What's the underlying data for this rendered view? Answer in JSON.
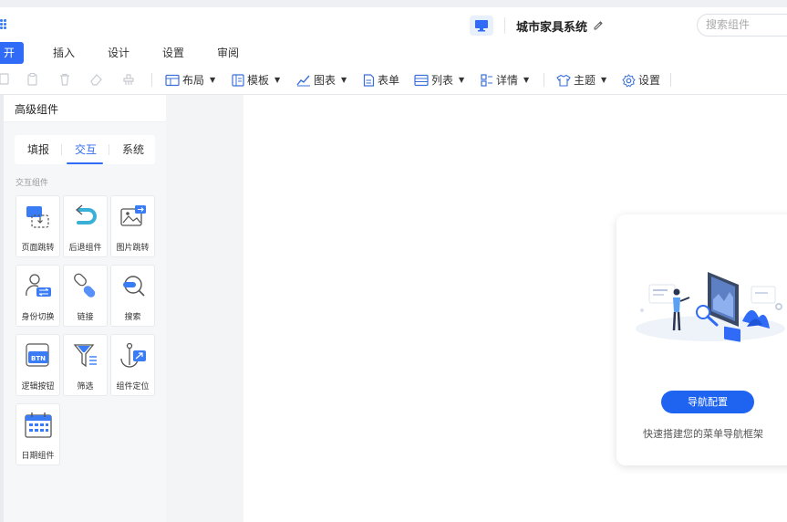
{
  "header": {
    "app_title": "城市家具系统",
    "search_placeholder": "搜索组件"
  },
  "menu": {
    "tabs": [
      {
        "label": "开始",
        "active": true
      },
      {
        "label": "插入"
      },
      {
        "label": "设计"
      },
      {
        "label": "设置"
      },
      {
        "label": "审阅"
      }
    ]
  },
  "toolbar": {
    "items": [
      {
        "label": "布局",
        "icon": "layout-icon",
        "dropdown": true
      },
      {
        "label": "模板",
        "icon": "template-icon",
        "dropdown": true
      },
      {
        "label": "图表",
        "icon": "chart-icon",
        "dropdown": true
      },
      {
        "label": "表单",
        "icon": "form-icon",
        "dropdown": false
      },
      {
        "label": "列表",
        "icon": "list-icon",
        "dropdown": true
      },
      {
        "label": "详情",
        "icon": "detail-icon",
        "dropdown": true
      },
      {
        "label": "主题",
        "icon": "theme-icon",
        "dropdown": true
      },
      {
        "label": "设置",
        "icon": "settings-icon",
        "dropdown": false
      }
    ]
  },
  "left_panel": {
    "title": "高级组件",
    "tabs": [
      {
        "label": "填报"
      },
      {
        "label": "交互",
        "active": true
      },
      {
        "label": "系统"
      }
    ],
    "section_label": "交互组件",
    "components": [
      {
        "label": "页面跳转",
        "icon": "page-jump-icon"
      },
      {
        "label": "后退组件",
        "icon": "back-arrow-icon"
      },
      {
        "label": "图片跳转",
        "icon": "image-jump-icon"
      },
      {
        "label": "身份切换",
        "icon": "user-switch-icon"
      },
      {
        "label": "链接",
        "icon": "link-icon"
      },
      {
        "label": "搜索",
        "icon": "search-icon"
      },
      {
        "label": "逻辑按钮",
        "icon": "logic-button-icon"
      },
      {
        "label": "筛选",
        "icon": "filter-icon"
      },
      {
        "label": "组件定位",
        "icon": "anchor-icon"
      },
      {
        "label": "日期组件",
        "icon": "calendar-icon"
      }
    ]
  },
  "nav_card": {
    "button_label": "导航配置",
    "description": "快速搭建您的菜单导航框架"
  },
  "colors": {
    "accent": "#2f6bf6",
    "button": "#1f64f0",
    "panel_bg": "#f6f7f9"
  }
}
